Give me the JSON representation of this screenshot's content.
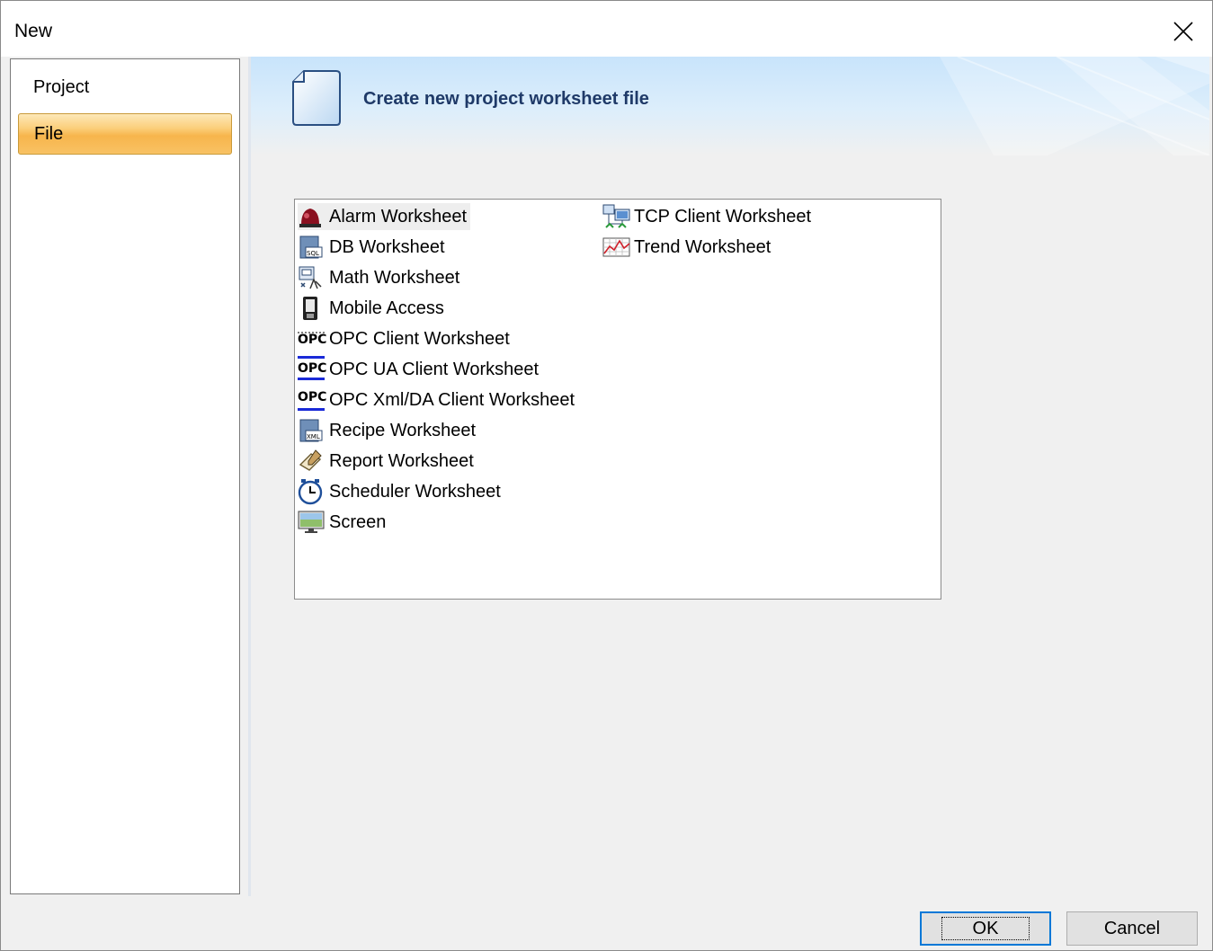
{
  "window": {
    "title": "New"
  },
  "sidebar": {
    "items": [
      {
        "label": "Project",
        "selected": false
      },
      {
        "label": "File",
        "selected": true
      }
    ]
  },
  "header": {
    "title": "Create new project worksheet file"
  },
  "list": {
    "items": [
      {
        "label": "Alarm Worksheet",
        "icon": "alarm-icon",
        "selected": true
      },
      {
        "label": "DB Worksheet",
        "icon": "db-icon"
      },
      {
        "label": "Math Worksheet",
        "icon": "math-icon"
      },
      {
        "label": "Mobile Access",
        "icon": "mobile-icon"
      },
      {
        "label": "OPC Client Worksheet",
        "icon": "opc-icon"
      },
      {
        "label": "OPC UA Client Worksheet",
        "icon": "opc-ua-icon"
      },
      {
        "label": "OPC Xml/DA Client Worksheet",
        "icon": "opc-xml-icon"
      },
      {
        "label": "Recipe Worksheet",
        "icon": "recipe-icon"
      },
      {
        "label": "Report Worksheet",
        "icon": "report-icon"
      },
      {
        "label": "Scheduler Worksheet",
        "icon": "scheduler-icon"
      },
      {
        "label": "Screen",
        "icon": "screen-icon"
      },
      {
        "label": "TCP Client Worksheet",
        "icon": "tcp-icon"
      },
      {
        "label": "Trend Worksheet",
        "icon": "trend-icon"
      }
    ]
  },
  "buttons": {
    "ok": "OK",
    "cancel": "Cancel"
  },
  "colors": {
    "accent": "#0078d7",
    "header_text": "#1f3a68",
    "selected_tab": "#f7b54c"
  }
}
